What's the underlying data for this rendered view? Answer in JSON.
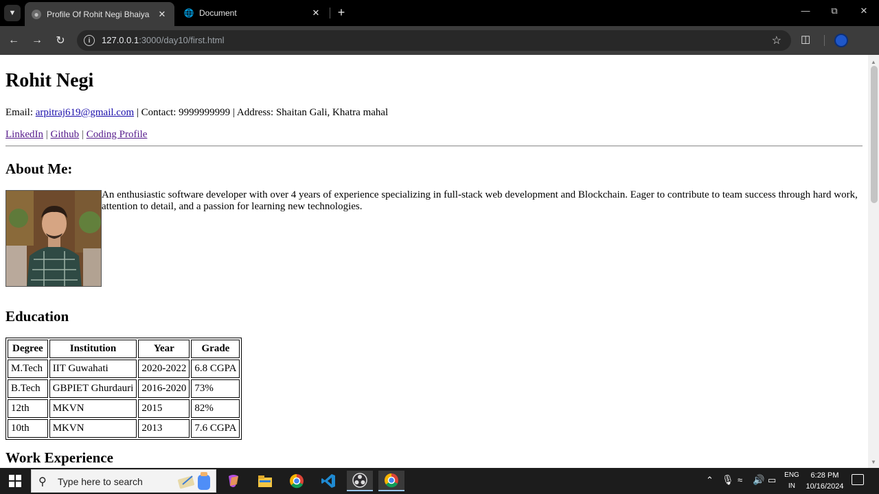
{
  "browser": {
    "tabs": [
      {
        "title": "Profile Of Rohit Negi Bhaiya",
        "active": true
      },
      {
        "title": "Document",
        "active": false
      }
    ],
    "url_host": "127.0.0.1",
    "url_rest": ":3000/day10/first.html"
  },
  "page": {
    "name": "Rohit Negi",
    "email_label": "Email: ",
    "email": "arpitraj619@gmail.com",
    "contact_label": " | Contact: 9999999999 | Address: Shaitan Gali, Khatra mahal",
    "links": [
      "LinkedIn",
      "Github",
      "Coding Profile"
    ],
    "link_sep": " | ",
    "about_heading": "About Me:",
    "about_text": "An enthusiastic software developer with over 4 years of experience specializing in full-stack web development and Blockchain. Eager to contribute to team success through hard work, attention to detail, and a passion for learning new technologies.",
    "education_heading": "Education",
    "education": {
      "headers": [
        "Degree",
        "Institution",
        "Year",
        "Grade"
      ],
      "rows": [
        [
          "M.Tech",
          "IIT Guwahati",
          "2020-2022",
          "6.8 CGPA"
        ],
        [
          "B.Tech",
          "GBPIET Ghurdauri",
          "2016-2020",
          "73%"
        ],
        [
          "12th",
          "MKVN",
          "2015",
          "82%"
        ],
        [
          "10th",
          "MKVN",
          "2013",
          "7.6 CGPA"
        ]
      ]
    },
    "work_heading": "Work Experience"
  },
  "taskbar": {
    "search_placeholder": "Type here to search",
    "lang_line1": "ENG",
    "lang_line2": "IN",
    "time": "6:28 PM",
    "date": "10/16/2024"
  },
  "colors": {
    "link": "#1a0dab",
    "visited": "#551a8b",
    "chrome_dark": "#3c3c3c"
  }
}
